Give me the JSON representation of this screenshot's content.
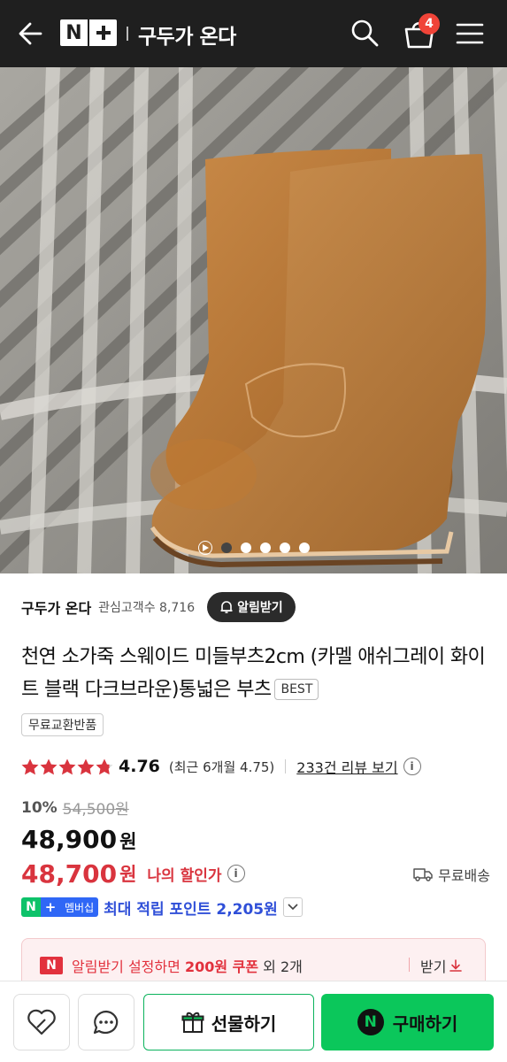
{
  "header": {
    "logo_letter": "N",
    "store_title": "구두가 온다",
    "cart_count": "4"
  },
  "gallery": {
    "slide_count": 6,
    "active_index": 1
  },
  "store": {
    "name": "구두가 온다",
    "fans": "관심고객수 8,716",
    "notify_label": "알림받기"
  },
  "product": {
    "title": "천연 소가죽 스웨이드 미들부츠2cm (카멜 애쉬그레이 화이트 블랙 다크브라운)통넓은 부츠",
    "badge": "BEST",
    "exchange_tag": "무료교환반품"
  },
  "rating": {
    "value": "4.76",
    "stars": 4.76,
    "recent": "(최근 6개월 4.75)",
    "reviews_link": "233건 리뷰 보기",
    "info": "i"
  },
  "price": {
    "discount": "10%",
    "original": "54,500원",
    "sale": "48,900",
    "sale_unit": "원",
    "my_price": "48,700",
    "my_unit": "원",
    "my_label": "나의 할인가",
    "shipping": "무료배송"
  },
  "points": {
    "badge_n": "N",
    "badge_plus": "+",
    "badge_member": "멤버십",
    "text": "최대 적립 포인트 2,205원"
  },
  "coupon": {
    "icon_letter": "N",
    "prefix": "알림받기 설정하면 ",
    "amount": "200원 쿠폰",
    "suffix": " 외 2개",
    "get_label": "받기"
  },
  "bottom": {
    "gift_label": "선물하기",
    "buy_letter": "N",
    "buy_label": "구매하기"
  },
  "colors": {
    "header_bg": "#1f1f1f",
    "accent_red": "#d9343e",
    "naver_green": "#0bc75b",
    "membership_blue": "#2f67f6"
  }
}
